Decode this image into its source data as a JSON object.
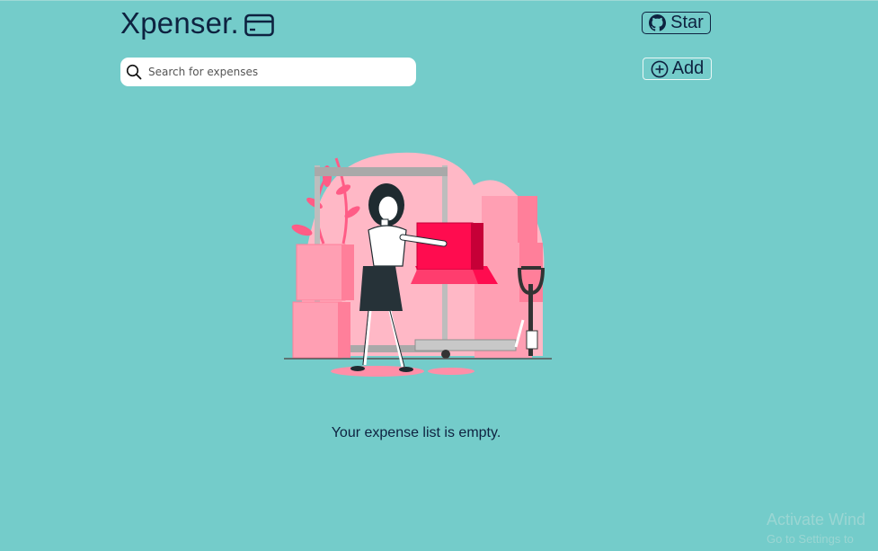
{
  "app": {
    "brand": "Xpenser."
  },
  "header": {
    "star_label": "Star",
    "add_label": "Add"
  },
  "search": {
    "placeholder": "Search for expenses",
    "value": ""
  },
  "main": {
    "empty_message": "Your expense list is empty."
  },
  "watermark": {
    "title": "Activate Wind",
    "subtitle": "Go to Settings to"
  },
  "icons": {
    "brand": "credit-card-icon",
    "star": "github-icon",
    "search": "search-icon",
    "add": "plus-circle-icon",
    "illustration": "empty-state-illustration"
  },
  "colors": {
    "background": "#74ccca",
    "text": "#0e2240",
    "accent": "#ff0c4f",
    "pink": "#ff9fb3"
  }
}
